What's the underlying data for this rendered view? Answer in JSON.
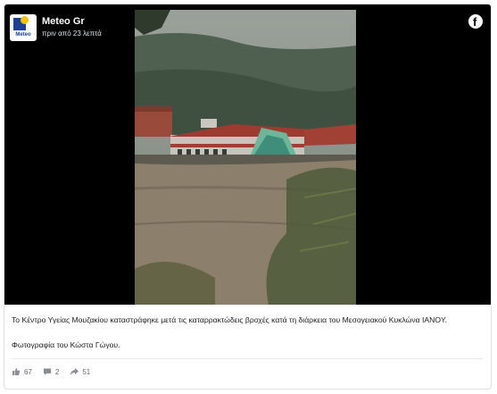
{
  "post": {
    "page_name": "Meteo Gr",
    "timestamp": "πριν από 23 λεπτά",
    "avatar_text": "Meteo",
    "caption": "Το Κέντρο Υγείας Μουζακίου καταστράφηκε μετά τις καταρρακτώδεις βροχές κατά τη διάρκεια του Μεσογειακού Κυκλώνα IANOY.",
    "credit": "Φωτογραφία του Κώστα Γώγου.",
    "likes": "67",
    "comments": "2",
    "shares": "51"
  },
  "icons": {
    "facebook": "f",
    "like": "like-icon",
    "comment": "comment-icon",
    "share": "share-icon"
  },
  "colors": {
    "brand_blue": "#1c3f94",
    "brand_yellow": "#f5c400",
    "floodwater": "#8c7f6c"
  }
}
